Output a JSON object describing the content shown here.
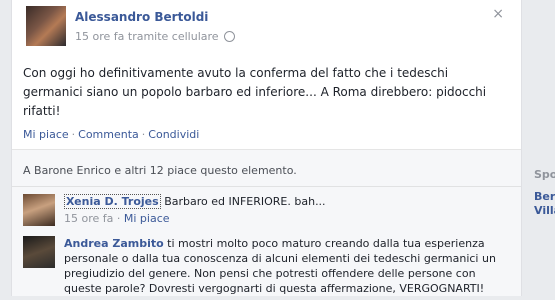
{
  "post": {
    "author": "Alessandro Bertoldi",
    "meta": "15 ore fa tramite cellulare",
    "text": "Con oggi ho definitivamente avuto la conferma del fatto che i tedeschi germanici siano un popolo barbaro ed inferiore... A Roma direbbero: pidocchi rifatti!",
    "close_symbol": "×"
  },
  "actions": {
    "like": "Mi piace",
    "comment": "Commenta",
    "share": "Condividi",
    "separator": "·"
  },
  "likes_text": "A Barone Enrico e altri 12 piace questo elemento.",
  "comments": [
    {
      "author": "Xenia D. Trojes",
      "text": " Barbaro ed INFERIORE. bah...",
      "time": "15 ore fa",
      "separator": "·",
      "like": "Mi piace"
    },
    {
      "author": "Andrea Zambito",
      "text": " ti mostri molto poco maturo creando dalla tua esperienza personale o dalla tua conoscenza di alcuni elementi dei tedeschi germanici un pregiudizio del genere. Non pensi che potresti offendere delle persone con queste parole? Dovresti vergognarti di questa affermazione, VERGOGNARTI!"
    }
  ],
  "sidebar": {
    "heading": "Spo",
    "item_line1": "Bert",
    "item_line2": "Villa"
  }
}
